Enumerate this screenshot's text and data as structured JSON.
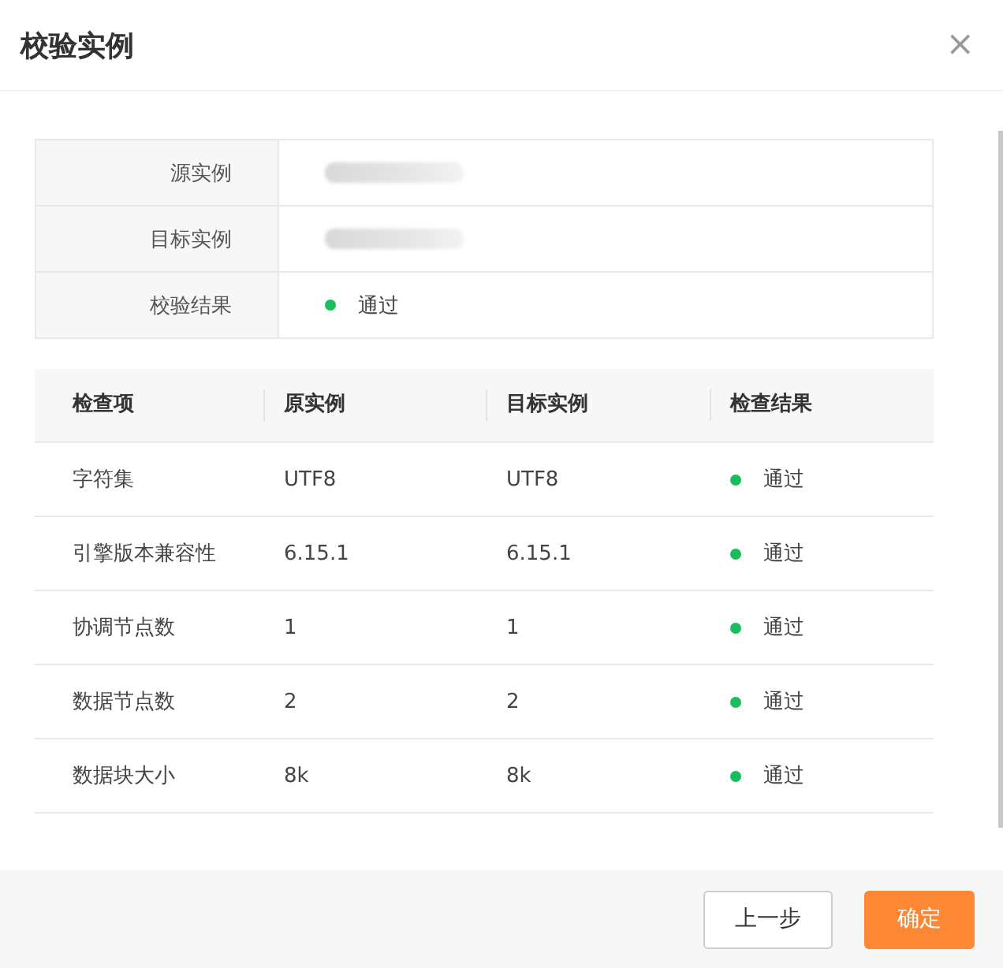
{
  "dialog": {
    "title": "校验实例",
    "close": "×"
  },
  "summary": [
    {
      "label": "源实例",
      "kind": "redacted"
    },
    {
      "label": "目标实例",
      "kind": "redacted"
    },
    {
      "label": "校验结果",
      "kind": "status",
      "color": "#19be5c",
      "value": "通过"
    }
  ],
  "table": {
    "columns": [
      "检查项",
      "原实例",
      "目标实例",
      "检查结果"
    ],
    "rows": [
      {
        "item": "字符集",
        "source": "UTF8",
        "target": "UTF8",
        "color": "#19be5c",
        "result": "通过"
      },
      {
        "item": "引擎版本兼容性",
        "source": "6.15.1",
        "target": "6.15.1",
        "color": "#19be5c",
        "result": "通过"
      },
      {
        "item": "协调节点数",
        "source": "1",
        "target": "1",
        "color": "#19be5c",
        "result": "通过"
      },
      {
        "item": "数据节点数",
        "source": "2",
        "target": "2",
        "color": "#19be5c",
        "result": "通过"
      },
      {
        "item": "数据块大小",
        "source": "8k",
        "target": "8k",
        "color": "#19be5c",
        "result": "通过"
      }
    ]
  },
  "buttons": [
    {
      "label": "上一步",
      "kind": "secondary"
    },
    {
      "label": "确定",
      "kind": "primary"
    }
  ]
}
